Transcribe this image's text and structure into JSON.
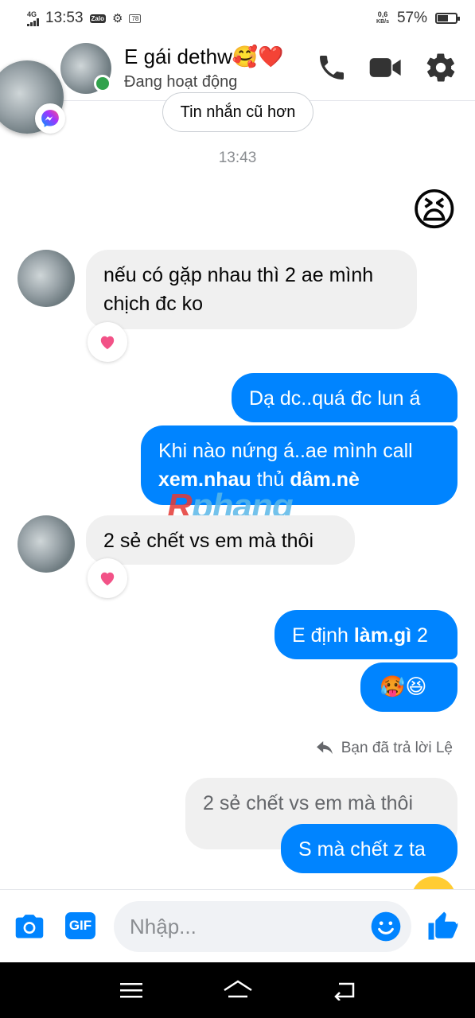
{
  "status_bar": {
    "network": "4G",
    "time": "13:53",
    "notif_badge": "78",
    "speed_value": "0,6",
    "speed_unit": "KB/s",
    "battery": "57%",
    "battery_level": 0.57
  },
  "header": {
    "contact_name": "E gái dethw🥰❤️",
    "contact_status": "Đang hoạt động"
  },
  "older_messages_button": "Tin nhắn cũ hơn",
  "timestamp": "13:43",
  "messages": {
    "m0_emoji": "😫",
    "m1": {
      "line1": "nếu có gặp nhau thì 2 ae mình",
      "line2": "chịch đc ko"
    },
    "m2": "Dạ dc..quá đc lun á",
    "m3": {
      "line1": "Khi nào nứng á..ae mình call",
      "line2a": "xem.nhau",
      "line2b": " thủ ",
      "line2c": "dâm.nè"
    },
    "m4": "2 sẻ chết vs em mà thôi",
    "m5": {
      "a": "E định ",
      "b": "làm.gì",
      "c": " 2"
    },
    "m6": "🥵😆",
    "reply_note": "Bạn đã trả lời Lệ",
    "m7_quoted": "2 sẻ chết vs em mà thôi",
    "m8": "S mà chết z ta"
  },
  "watermark": {
    "first": "R",
    "rest": "phang"
  },
  "composer": {
    "gif_label": "GIF",
    "placeholder": "Nhập..."
  },
  "colors": {
    "accent": "#0084ff",
    "incoming_bubble": "#f0f0f0",
    "online": "#31a24c",
    "heart": "#f25287"
  },
  "icons": [
    "phone-icon",
    "video-icon",
    "gear-icon",
    "camera-icon",
    "emoji-icon",
    "thumbs-up-icon",
    "reply-icon",
    "menu-icon",
    "home-icon",
    "back-icon"
  ]
}
